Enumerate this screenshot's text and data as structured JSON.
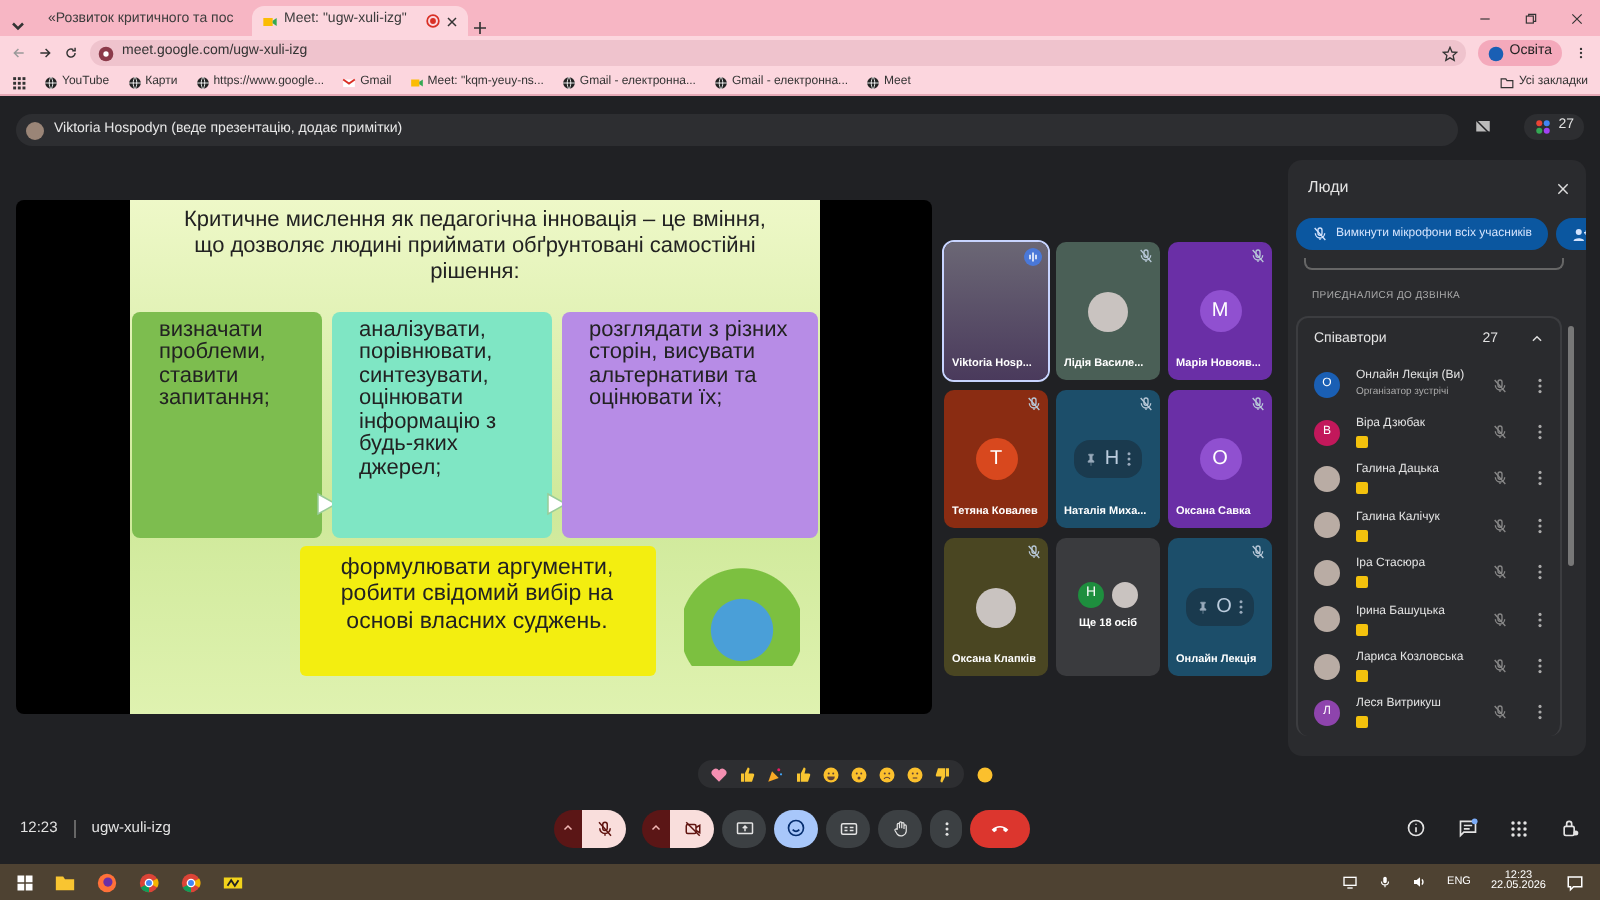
{
  "browser": {
    "tabs": [
      {
        "title": "«Розвиток критичного та пос",
        "selected": false,
        "kind": "mail"
      },
      {
        "title": "Meet: \"ugw-xuli-izg\"",
        "selected": true,
        "kind": "meet"
      }
    ],
    "address": "meet.google.com/ugw-xuli-izg",
    "profile": "Освіта",
    "bookmarks": [
      {
        "title": "YouTube",
        "kind": "globe"
      },
      {
        "title": "Карти",
        "kind": "globe"
      },
      {
        "title": "https://www.google...",
        "kind": "globe"
      },
      {
        "title": "Gmail",
        "kind": "mail"
      },
      {
        "title": "Meet: \"kqm-yeuy-ns...",
        "kind": "meet"
      },
      {
        "title": "Gmail - електронна...",
        "kind": "globe"
      },
      {
        "title": "Gmail - електронна...",
        "kind": "globe"
      },
      {
        "title": "Meet",
        "kind": "globe"
      }
    ],
    "all_bookmarks": "Усі закладки"
  },
  "meet": {
    "presenter_banner": "Viktoria Hospodyn (веде презентацію, додає примітки)",
    "participant_count": "27",
    "slide": {
      "title": "Критичне мислення як педагогічна інновація – це вміння, що дозволяє людині приймати обґрунтовані самостійні рішення:",
      "boxes": [
        {
          "text": "визначати проблеми, ставити запитання;",
          "color": "#7dbd4f"
        },
        {
          "text": "аналізувати, порівнювати, синтезувати, оцінювати інформацію з будь-яких джерел;",
          "color": "#7fe6c4"
        },
        {
          "text": "розглядати з різних сторін, висувати альтернативи та оцінювати їх;",
          "color": "#b78ce6"
        }
      ],
      "conclusion": "формулювати аргументи, робити свідомий вибір на основі власних суджень."
    },
    "tiles": [
      {
        "name": "Viktoria Hosp...",
        "kind": "video",
        "speaking": true,
        "selected": true
      },
      {
        "name": "Лідія Василе...",
        "kind": "photo",
        "color": "#4a5f56",
        "speaking": false,
        "muted": true,
        "selected": false
      },
      {
        "name": "Марія Новояв...",
        "kind": "letter",
        "avatar": {
          "letter": "M",
          "color": "#9050d0"
        },
        "color": "#6a2fa6",
        "speaking": false,
        "muted": true,
        "selected": false
      },
      {
        "name": "Тетяна Ковалев",
        "kind": "letter",
        "avatar": {
          "letter": "T",
          "color": "#d8481e"
        },
        "color": "#8a2c12",
        "speaking": false,
        "muted": true,
        "selected": false
      },
      {
        "name": "Наталія Миха...",
        "kind": "hover",
        "letter": "Н",
        "color": "#1c4e6a",
        "speaking": false,
        "muted": true,
        "selected": false
      },
      {
        "name": "Оксана Савка",
        "kind": "letter",
        "avatar": {
          "letter": "О",
          "color": "#9050d0"
        },
        "color": "#6a2fa6",
        "speaking": false,
        "muted": true,
        "selected": false
      },
      {
        "name": "Оксана Клапків",
        "kind": "photo",
        "color": "#4a4622",
        "speaking": false,
        "muted": true,
        "selected": false
      },
      {
        "kind": "more",
        "label": "Ще 18 осіб",
        "avatar": {
          "letter": "H",
          "color": "#1e8e3e"
        },
        "color": "#3a3b3e",
        "selected": false
      },
      {
        "name": "Онлайн Лекція",
        "kind": "hover",
        "letter": "О",
        "color": "#1c4e6a",
        "speaking": false,
        "muted": true,
        "selected": false
      }
    ],
    "people_panel": {
      "title": "Люди",
      "mute_all": "Вимкнути мікрофони всіх учасників",
      "section": "ПРИЄДНАЛИСЯ ДО ДЗВІНКА",
      "group": {
        "title": "Співавтори",
        "count": "27",
        "expanded": true
      },
      "participants": [
        {
          "name": "Онлайн Лекція (Ви)",
          "role": "Організатор зустрічі",
          "kind": "letter",
          "letter": "О",
          "color": "#1a5fb4",
          "muted": true
        },
        {
          "name": "Віра Дзюбак",
          "kind": "letter",
          "letter": "В",
          "color": "#c2185b",
          "badge": true,
          "muted": true
        },
        {
          "name": "Галина Дацька",
          "kind": "photo",
          "badge": true,
          "muted": true
        },
        {
          "name": "Галина Калічук",
          "kind": "photo",
          "badge": true,
          "muted": true
        },
        {
          "name": "Іра Стасюра",
          "kind": "photo",
          "badge": true,
          "muted": true
        },
        {
          "name": "Ірина Башуцька",
          "kind": "photo",
          "badge": true,
          "muted": true
        },
        {
          "name": "Лариса Козловська",
          "kind": "photo",
          "badge": true,
          "muted": true
        },
        {
          "name": "Леся Витрикуш",
          "kind": "letter",
          "letter": "Л",
          "color": "#8e44ad",
          "badge": true,
          "muted": true
        }
      ]
    },
    "time": "12:23",
    "meeting_code": "ugw-xuli-izg",
    "controls": {
      "mic_on": false,
      "camera_on": false,
      "reactions_selected": true,
      "chat_unread": true
    }
  },
  "taskbar": {
    "language": "ENG",
    "time": "12:23",
    "date": "22.05.2026"
  }
}
